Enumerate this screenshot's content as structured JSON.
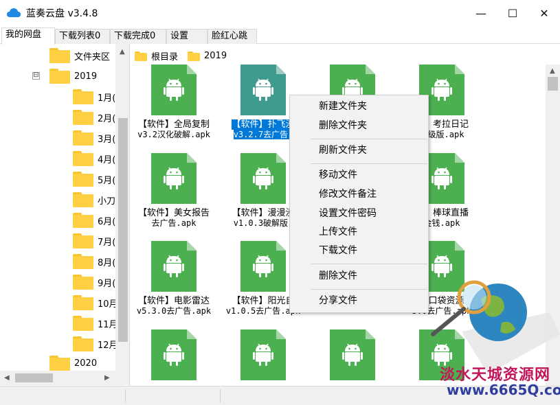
{
  "window": {
    "title": "蓝奏云盘 v3.4.8",
    "minimize_glyph": "—",
    "maximize_glyph": "☐",
    "close_glyph": "✕"
  },
  "tabs": [
    {
      "label": "我的网盘",
      "active": true
    },
    {
      "label": "下载列表0"
    },
    {
      "label": "下载完成0"
    },
    {
      "label": "设置"
    },
    {
      "label": "脸红心跳"
    }
  ],
  "tree": {
    "root_label": "文件夹区",
    "expander": "⊟",
    "open_folder": "2019",
    "children": [
      "1月(",
      "2月(",
      "3月(",
      "4月(",
      "5月(",
      "小刀",
      "6月(",
      "7月(",
      "8月(",
      "9月(",
      "10月",
      "11月",
      "12月"
    ],
    "next_folder": "2020"
  },
  "breadcrumb": {
    "root": "根目录",
    "current": "2019"
  },
  "files": [
    {
      "line1": "【软件】全局复制",
      "line2": "v3.2汉化破解.apk"
    },
    {
      "line1": "【软件】扑飞漫",
      "line2": "v3.2.7去广告.",
      "selected": true
    },
    {
      "line1": "",
      "line2": ""
    },
    {
      "line1": "件】考拉日记",
      "line2": "高级版.apk"
    },
    {
      "line1": "【软件】美女报告",
      "line2": "去广告.apk"
    },
    {
      "line1": "【软件】漫漫漫",
      "line2": "v1.0.3破解版."
    },
    {
      "line1": "",
      "line2": ""
    },
    {
      "line1": "戏】棒球直播",
      "line2": "金钱.apk"
    },
    {
      "line1": "【软件】电影雷达",
      "line2": "v5.3.0去广告.apk"
    },
    {
      "line1": "【软件】阳光自",
      "line2": "v1.0.5去广告.apk"
    },
    {
      "line1": "",
      "line2": ""
    },
    {
      "line1": "】口袋资源",
      "line2": "5.0去广告.apk"
    },
    {
      "line1": "",
      "line2": ""
    },
    {
      "line1": "",
      "line2": ""
    },
    {
      "line1": "",
      "line2": ""
    },
    {
      "line1": "",
      "line2": ""
    }
  ],
  "context_menu": {
    "items": [
      "新建文件夹",
      "删除文件夹",
      "刷新文件夹",
      "移动文件",
      "修改文件备注",
      "设置文件密码",
      "上传文件",
      "下载文件",
      "删除文件",
      "分享文件"
    ]
  },
  "scroll_arrows": {
    "up": "▲",
    "down": "▼",
    "left": "◀",
    "right": "▶"
  },
  "watermark": {
    "text": "淡水天城资源网",
    "url": "www.6665Q.com"
  },
  "colors": {
    "apk_green": "#4caf50",
    "selection_blue": "#0078d7",
    "folder_yellow": "#ffd043"
  }
}
